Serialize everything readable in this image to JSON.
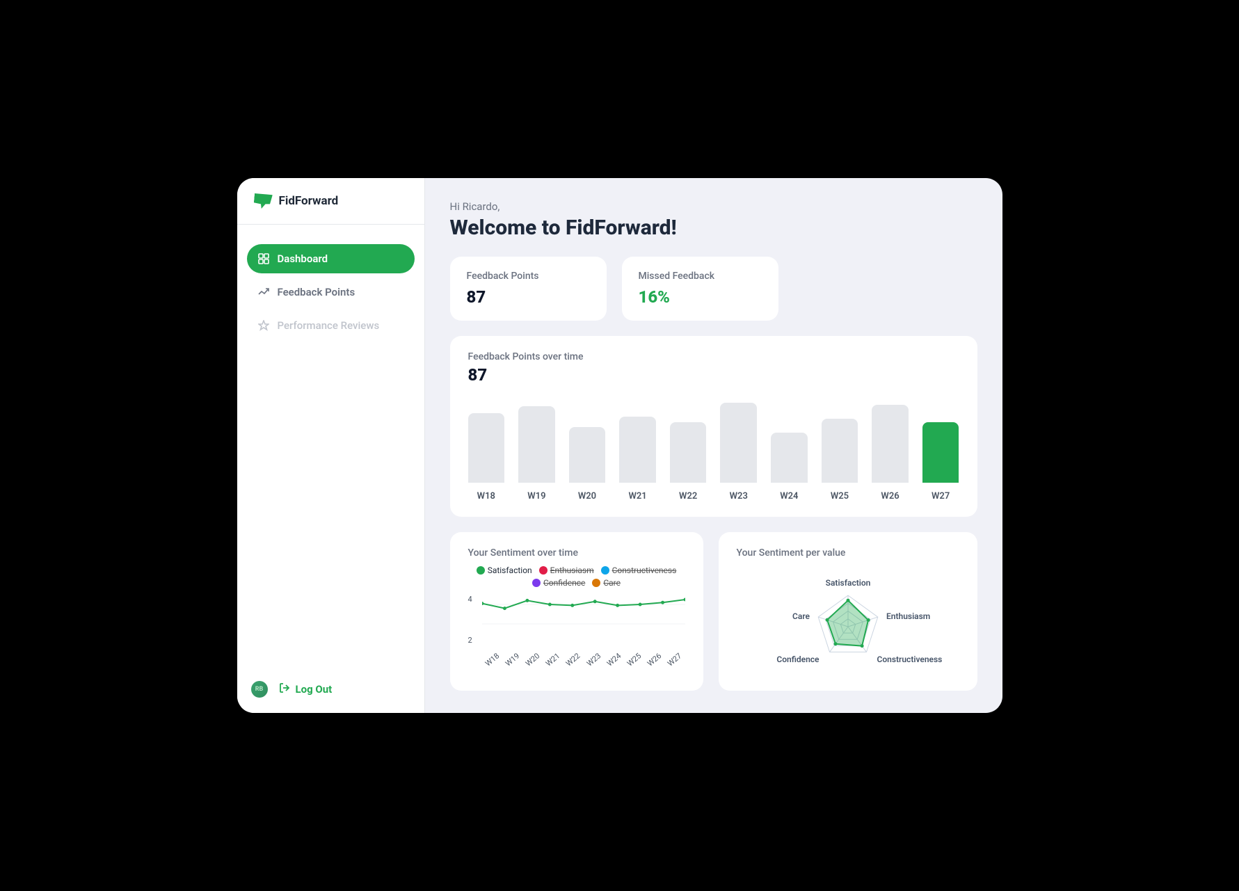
{
  "brand": "FidForward",
  "sidebar": {
    "items": [
      {
        "label": "Dashboard",
        "active": true
      },
      {
        "label": "Feedback Points",
        "active": false
      },
      {
        "label": "Performance Reviews",
        "active": false
      }
    ],
    "avatar_initials": "RB",
    "logout_label": "Log Out"
  },
  "header": {
    "greeting": "Hi Ricardo,",
    "welcome": "Welcome to FidForward!"
  },
  "kpis": {
    "feedback_label": "Feedback Points",
    "feedback_value": "87",
    "missed_label": "Missed Feedback",
    "missed_value": "16%"
  },
  "feedback_over_time": {
    "title": "Feedback Points over time",
    "big_value": "87"
  },
  "sentiment_time": {
    "title": "Your Sentiment over time",
    "legend": {
      "satisfaction": "Satisfaction",
      "enthusiasm": "Enthusiasm",
      "constructiveness": "Constructiveness",
      "confidence": "Confidence",
      "care": "Care"
    },
    "y_ticks": [
      "4",
      "2"
    ]
  },
  "sentiment_value": {
    "title": "Your Sentiment per value",
    "labels": {
      "satisfaction": "Satisfaction",
      "enthusiasm": "Enthusiasm",
      "constructiveness": "Constructiveness",
      "confidence": "Confidence",
      "care": "Care"
    }
  },
  "chart_data": [
    {
      "type": "bar",
      "title": "Feedback Points over time",
      "categories": [
        "W18",
        "W19",
        "W20",
        "W21",
        "W22",
        "W23",
        "W24",
        "W25",
        "W26",
        "W27"
      ],
      "values": [
        100,
        110,
        80,
        95,
        87,
        115,
        72,
        92,
        112,
        87
      ],
      "highlight_index": 9,
      "ylim": [
        0,
        120
      ]
    },
    {
      "type": "line",
      "title": "Your Sentiment over time",
      "x": [
        "W18",
        "W19",
        "W20",
        "W21",
        "W22",
        "W23",
        "W24",
        "W25",
        "W26",
        "W27"
      ],
      "series": [
        {
          "name": "Satisfaction",
          "values": [
            4.1,
            3.6,
            4.4,
            4.0,
            3.9,
            4.3,
            3.9,
            4.0,
            4.2,
            4.5
          ],
          "color": "#22A951",
          "active": true
        },
        {
          "name": "Enthusiasm",
          "color": "#E11D48",
          "active": false
        },
        {
          "name": "Constructiveness",
          "color": "#0EA5E9",
          "active": false
        },
        {
          "name": "Confidence",
          "color": "#7C3AED",
          "active": false
        },
        {
          "name": "Care",
          "color": "#D97706",
          "active": false
        }
      ],
      "ylim": [
        0,
        5
      ],
      "ylabel": "",
      "xlabel": ""
    },
    {
      "type": "radar",
      "title": "Your Sentiment per value",
      "categories": [
        "Satisfaction",
        "Enthusiasm",
        "Constructiveness",
        "Confidence",
        "Care"
      ],
      "values": [
        4.2,
        3.4,
        3.8,
        3.4,
        3.5
      ],
      "max": 5,
      "color": "#22A951"
    }
  ]
}
